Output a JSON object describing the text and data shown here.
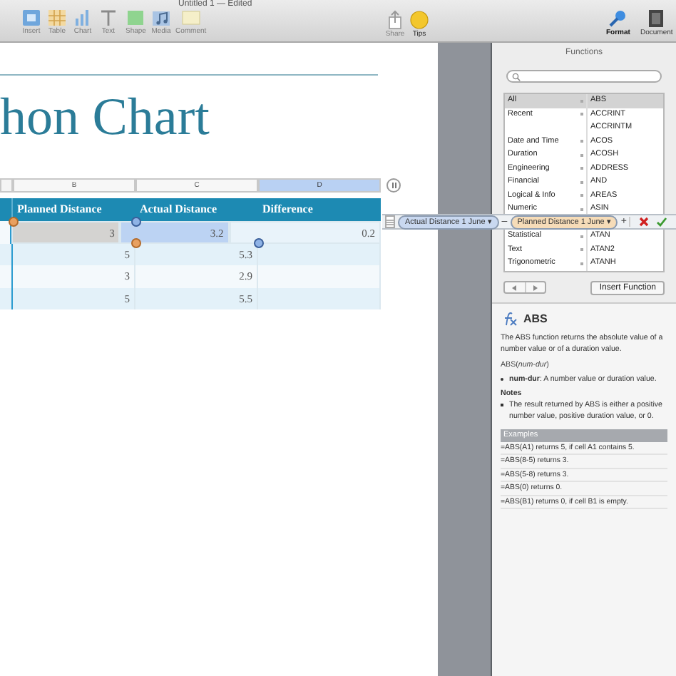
{
  "window": {
    "title": "Untitled 1 — Edited"
  },
  "toolbar": {
    "left": [
      {
        "label": "Insert"
      },
      {
        "label": "Table"
      },
      {
        "label": "Chart"
      },
      {
        "label": "Text"
      },
      {
        "label": "Shape"
      },
      {
        "label": "Media"
      },
      {
        "label": "Comment"
      }
    ],
    "middle": [
      {
        "label": "Share",
        "disabled": true
      },
      {
        "label": "Tips",
        "disabled": false
      }
    ],
    "right": [
      {
        "label": "Format",
        "selected": true
      },
      {
        "label": "Document",
        "selected": false
      }
    ]
  },
  "sheet": {
    "title": "hon Chart",
    "column_headers": [
      {
        "label": "B",
        "selected": false
      },
      {
        "label": "C",
        "selected": false
      },
      {
        "label": "D",
        "selected": true
      }
    ],
    "header_row": [
      "Planned Distance",
      "Actual Distance",
      "Difference"
    ],
    "rows": [
      {
        "cells": [
          {
            "text": "3",
            "selected": true,
            "kind": "reference"
          },
          {
            "text": "3.2",
            "selected": true,
            "kind": "editing"
          },
          {
            "text": "0.2",
            "selected": false,
            "kind": "plain"
          }
        ]
      },
      {
        "cells": [
          {
            "text": "5",
            "selected": false,
            "kind": "plain"
          },
          {
            "text": "5.3",
            "selected": false,
            "kind": "plain"
          },
          {
            "selected": false,
            "kind": "plain"
          }
        ]
      },
      {
        "cells": [
          {
            "text": "3",
            "selected": false,
            "kind": "plain"
          },
          {
            "text": "2.9",
            "selected": false,
            "kind": "plain"
          },
          {
            "selected": false,
            "kind": "plain"
          }
        ]
      },
      {
        "cells": [
          {
            "text": "5",
            "selected": false,
            "kind": "plain"
          },
          {
            "text": "5.5",
            "selected": false,
            "kind": "plain"
          },
          {
            "selected": false,
            "kind": "plain"
          }
        ]
      }
    ]
  },
  "formula": {
    "parts": [
      {
        "kind": "token",
        "text": "Actual Distance 1 June ▾",
        "color": "#c9d8f0"
      },
      {
        "kind": "operator",
        "text": "–"
      },
      {
        "kind": "token",
        "text": "Planned Distance 1 June ▾",
        "color": "#f6dcb8"
      },
      {
        "kind": "operator",
        "text": "+"
      }
    ]
  },
  "functions": {
    "title": "Functions",
    "rows_above_formula": [
      {
        "category": "All",
        "function": "ABS",
        "selected": true
      },
      {
        "category": "Recent",
        "function": "ACCRINT",
        "selected": false
      },
      {
        "function": "ACCRINTM",
        "selected": false
      },
      {
        "category": "Date and Time",
        "function": "ACOS",
        "selected": false
      },
      {
        "category": "Duration",
        "function": "ACOSH",
        "selected": false
      },
      {
        "category": "Engineering",
        "function": "ADDRESS",
        "selected": false
      },
      {
        "category": "Financial",
        "function": "AND",
        "selected": false
      },
      {
        "category": "Logical & Info",
        "function": "AREAS",
        "selected": false
      },
      {
        "category": "Numeric",
        "function": "ASIN",
        "selected": false
      }
    ],
    "rows_below_formula": [
      {
        "category": "Statistical",
        "function": "ATAN",
        "selected": false
      },
      {
        "category": "Text",
        "function": "ATAN2",
        "selected": false
      },
      {
        "category": "Trigonometric",
        "function": "ATANH",
        "selected": false
      }
    ],
    "insert_button": "Insert Function",
    "help": {
      "name": "ABS",
      "description": "The ABS function returns the absolute value of a number value or of a duration value.",
      "syntax": "ABS(*num-dur*)",
      "arguments": [
        "**num-dur**: A number value or duration value."
      ],
      "notes_heading": "Notes",
      "notes": [
        "The result returned by ABS is either a positive number value, positive duration value, or 0."
      ],
      "examples_heading": "Examples",
      "examples": [
        "=ABS(A1) returns 5, if cell A1 contains 5.",
        "=ABS(8-5) returns 3.",
        "=ABS(5-8) returns 3.",
        "=ABS(0) returns 0.",
        "=ABS(B1) returns 0, if cell B1 is empty."
      ]
    }
  }
}
